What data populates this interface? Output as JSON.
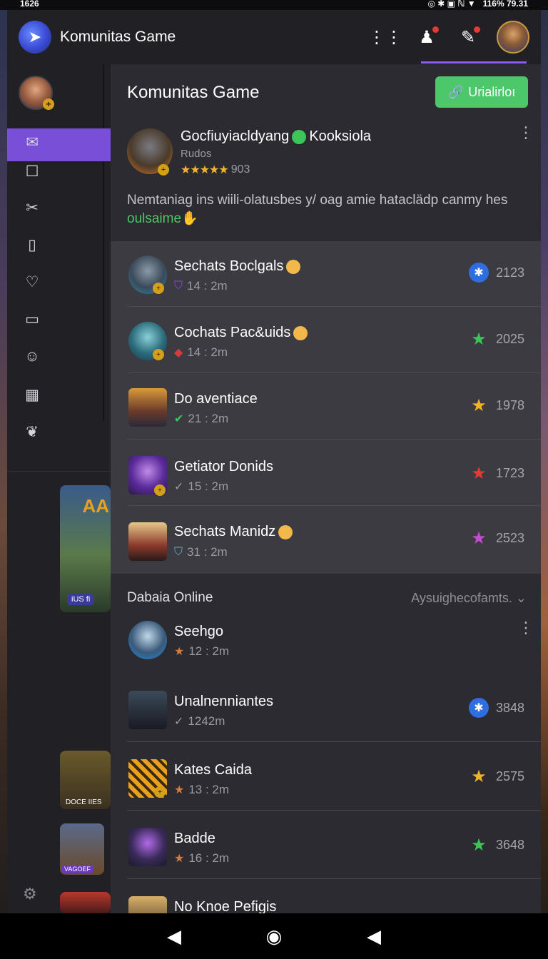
{
  "status_bar": {
    "time": "1626",
    "right": "116%  79.31"
  },
  "app": {
    "title": "Komunitas Game"
  },
  "main": {
    "title": "Komunitas Game",
    "primary_button": "Urialirloı",
    "featured": {
      "name": "Gocfiuyiacldyang",
      "name_suffix": "Kooksiola",
      "subtitle": "Rudos",
      "rating": "903",
      "description_start": "Nemtaniag ins wiili-olatusbes y/ oag amie hataclädp canmy hes ",
      "description_highlight": "oulsaime"
    },
    "list": [
      {
        "name": "Sechats Boclgals",
        "time": "14 : 2m",
        "score": "2123",
        "score_icon": "blue-badge-icon",
        "star_color": "#2f6ee0"
      },
      {
        "name": "Cochats Pac&uids",
        "time": "14 : 2m",
        "score": "2025",
        "score_icon": "green-star-icon",
        "star_color": "#3ec55a"
      },
      {
        "name": "Do aventiace",
        "time": "21 : 2m",
        "score": "1978",
        "score_icon": "gold-star-icon",
        "star_color": "#f0b429"
      },
      {
        "name": "Getiator Donids",
        "time": "15 : 2m",
        "score": "1723",
        "score_icon": "red-star-icon",
        "star_color": "#e53935"
      },
      {
        "name": "Sechats Manidz",
        "time": "31 : 2m",
        "score": "2523",
        "score_icon": "purple-star-icon",
        "star_color": "#c84ad8"
      }
    ],
    "online_section": {
      "title": "Dabaia Online",
      "sort_label": "Aysuighecofamts."
    },
    "online": [
      {
        "name": "Seehgo",
        "time": "12 : 2m",
        "score": ""
      },
      {
        "name": "Unalnenniantes",
        "time": "1242m",
        "score": "3848",
        "score_icon": "blue-badge-icon"
      },
      {
        "name": "Kates Caida",
        "time": "13 : 2m",
        "score": "2575",
        "score_icon": "gold-star-icon"
      },
      {
        "name": "Badde",
        "time": "16 : 2m",
        "score": "3648",
        "score_icon": "green-star-icon"
      },
      {
        "name": "No Knoe Pefigis",
        "time": "",
        "score": ""
      }
    ]
  },
  "sidebar": {
    "cards": [
      {
        "label": "iUS fi"
      },
      {
        "label": "DOCE IIES"
      },
      {
        "label": "VAGOEF"
      }
    ]
  },
  "colors": {
    "accent": "#7a4fd8",
    "primary_button": "#4cc76a",
    "background": "#2b2b31"
  }
}
